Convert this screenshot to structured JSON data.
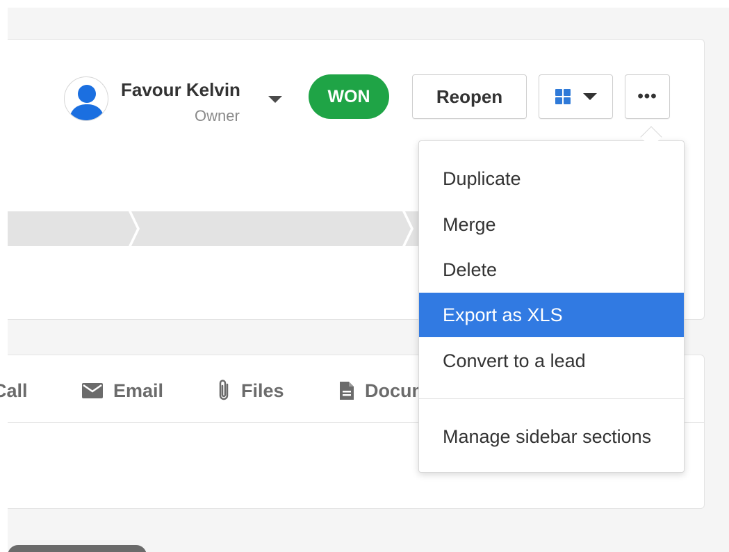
{
  "owner": {
    "name": "Favour Kelvin",
    "role": "Owner"
  },
  "status": {
    "badge": "WON"
  },
  "actions": {
    "reopen_label": "Reopen",
    "more_label": "•••"
  },
  "tabs": [
    {
      "label": "Call",
      "icon": "phone-icon"
    },
    {
      "label": "Email",
      "icon": "envelope-icon"
    },
    {
      "label": "Files",
      "icon": "paperclip-icon"
    },
    {
      "label": "Documents",
      "icon": "document-icon"
    }
  ],
  "menu": {
    "items": [
      {
        "label": "Duplicate"
      },
      {
        "label": "Merge"
      },
      {
        "label": "Delete"
      },
      {
        "label": "Export as XLS",
        "highlighted": true
      },
      {
        "label": "Convert to a lead"
      }
    ],
    "footer_item": "Manage sidebar sections"
  },
  "colors": {
    "won_green": "#1fa446",
    "accent_blue": "#317ae2",
    "grid_icon_blue": "#2f7ad8",
    "page_background": "#f5f5f5"
  }
}
